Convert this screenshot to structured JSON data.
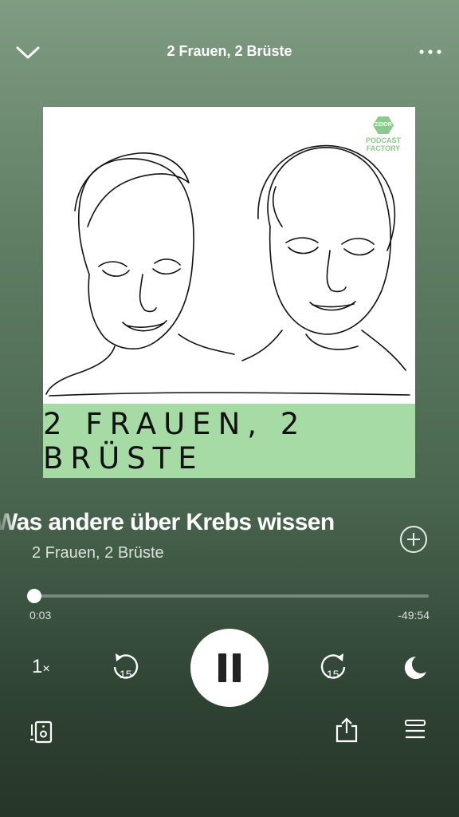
{
  "header": {
    "title": "2 Frauen, 2 Brüste"
  },
  "cover": {
    "title": "2 FRAUEN, 2 BRÜSTE",
    "logo_line1": "PODCAST",
    "logo_line2": "FACTORY",
    "logo_badge": "ZEIOR",
    "banner_color": "#a6dba6"
  },
  "episode": {
    "title": "Was andere über Krebs wissen",
    "show": "2 Frauen, 2 Brüste"
  },
  "progress": {
    "elapsed": "0:03",
    "remaining": "-49:54",
    "fraction": 0.001
  },
  "controls": {
    "speed": "1",
    "speed_suffix": "×",
    "skip_back": "15",
    "skip_forward": "15"
  },
  "icons": [
    "chevron-down-icon",
    "more-icon",
    "add-icon",
    "rewind-15-icon",
    "pause-icon",
    "forward-15-icon",
    "sleep-timer-icon",
    "devices-icon",
    "share-icon",
    "queue-icon"
  ]
}
